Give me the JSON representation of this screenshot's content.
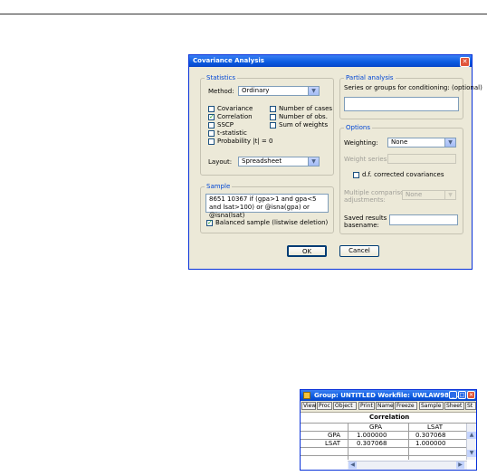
{
  "dialog": {
    "title": "Covariance Analysis",
    "statistics": {
      "label": "Statistics",
      "method_label": "Method:",
      "method_value": "Ordinary",
      "checks": [
        {
          "label": "Covariance",
          "checked": false
        },
        {
          "label": "Number of cases",
          "checked": false
        },
        {
          "label": "Correlation",
          "checked": true
        },
        {
          "label": "Number of obs.",
          "checked": false
        },
        {
          "label": "SSCP",
          "checked": false
        },
        {
          "label": "Sum of weights",
          "checked": false
        },
        {
          "label": "t-statistic",
          "checked": false
        },
        {
          "label": "Probability |t| = 0",
          "checked": false
        }
      ],
      "layout_label": "Layout:",
      "layout_value": "Spreadsheet"
    },
    "sample": {
      "label": "Sample",
      "text": "8651 10367 if (gpa>1 and gpa<5 and lsat>100) or @isna(gpa) or @isna(lsat)",
      "balanced_label": "Balanced sample (listwise deletion)",
      "balanced_checked": true
    },
    "partial": {
      "label": "Partial analysis",
      "series_label": "Series or groups for conditioning: (optional)"
    },
    "options": {
      "label": "Options",
      "weighting_label": "Weighting:",
      "weighting_value": "None",
      "weight_series_label": "Weight series:",
      "df_label": "d.f. corrected covariances",
      "multiple_label_1": "Multiple comparison",
      "multiple_label_2": "adjustments:",
      "multiple_value": "None",
      "saved_label_1": "Saved results",
      "saved_label_2": "basename:"
    },
    "ok_label": "OK",
    "cancel_label": "Cancel"
  },
  "group_window": {
    "title": "Group: UNTITLED   Workfile: UWLAW98:...",
    "toolbar": [
      "View",
      "Proc",
      "Object",
      "Print",
      "Name",
      "Freeze",
      "Sample",
      "Sheet",
      "St"
    ],
    "table_title": "Correlation",
    "columns": [
      "GPA",
      "LSAT"
    ],
    "rows": [
      {
        "name": "GPA",
        "values": [
          "1.000000",
          "0.307068"
        ]
      },
      {
        "name": "LSAT",
        "values": [
          "0.307068",
          "1.000000"
        ]
      }
    ]
  }
}
